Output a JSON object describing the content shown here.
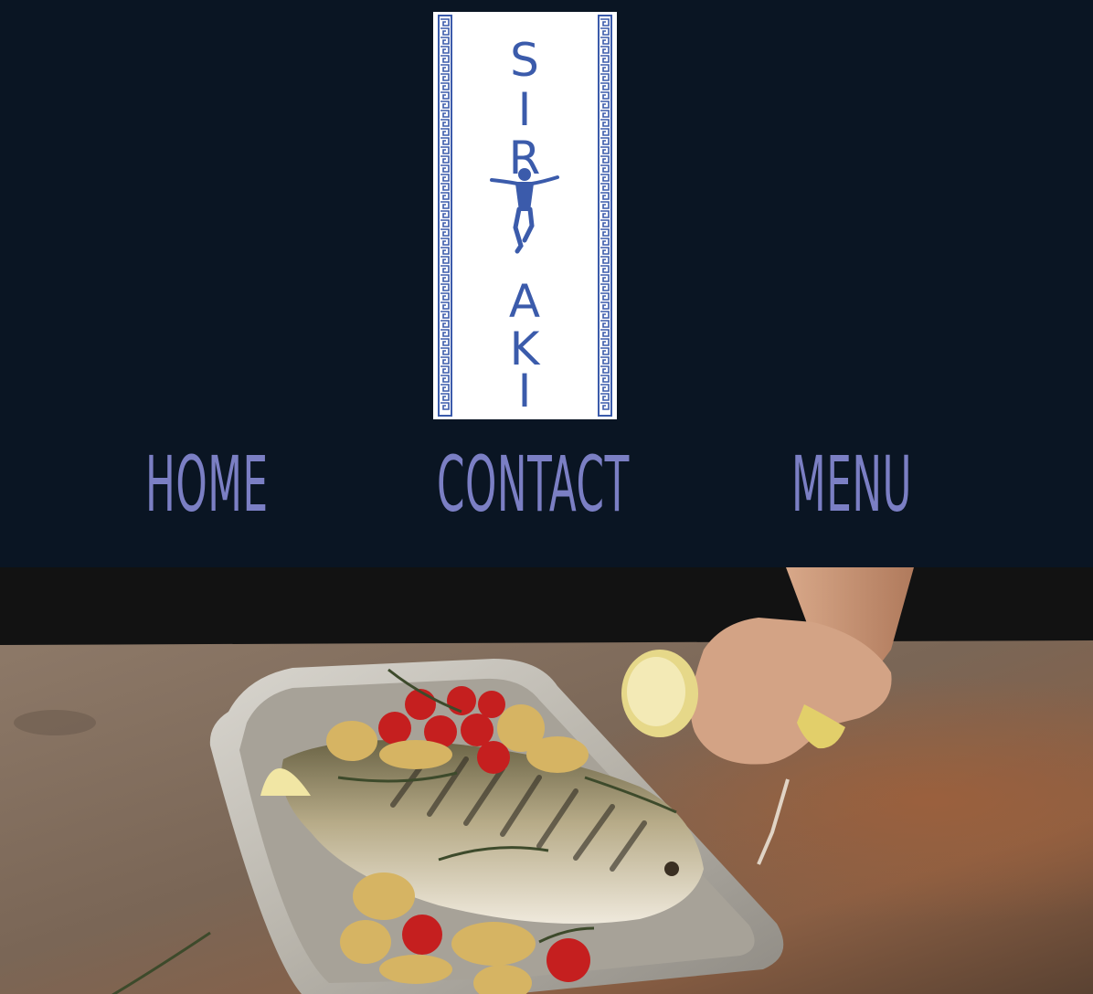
{
  "logo": {
    "letters_top": [
      "S",
      "I",
      "R"
    ],
    "letters_bottom": [
      "A",
      "K",
      "I"
    ],
    "colors": {
      "background": "#ffffff",
      "ink": "#3b5bab"
    }
  },
  "nav": {
    "items": [
      {
        "label": "HOME"
      },
      {
        "label": "CONTACT"
      },
      {
        "label": "MENU"
      }
    ]
  },
  "hero": {
    "subject": "grilled whole fish on a silver tray with potatoes, cherry tomatoes and lemon"
  },
  "colors": {
    "page_background": "#0a1523",
    "nav_text": "#7b7fc4",
    "logo_blue": "#3b5bab"
  }
}
